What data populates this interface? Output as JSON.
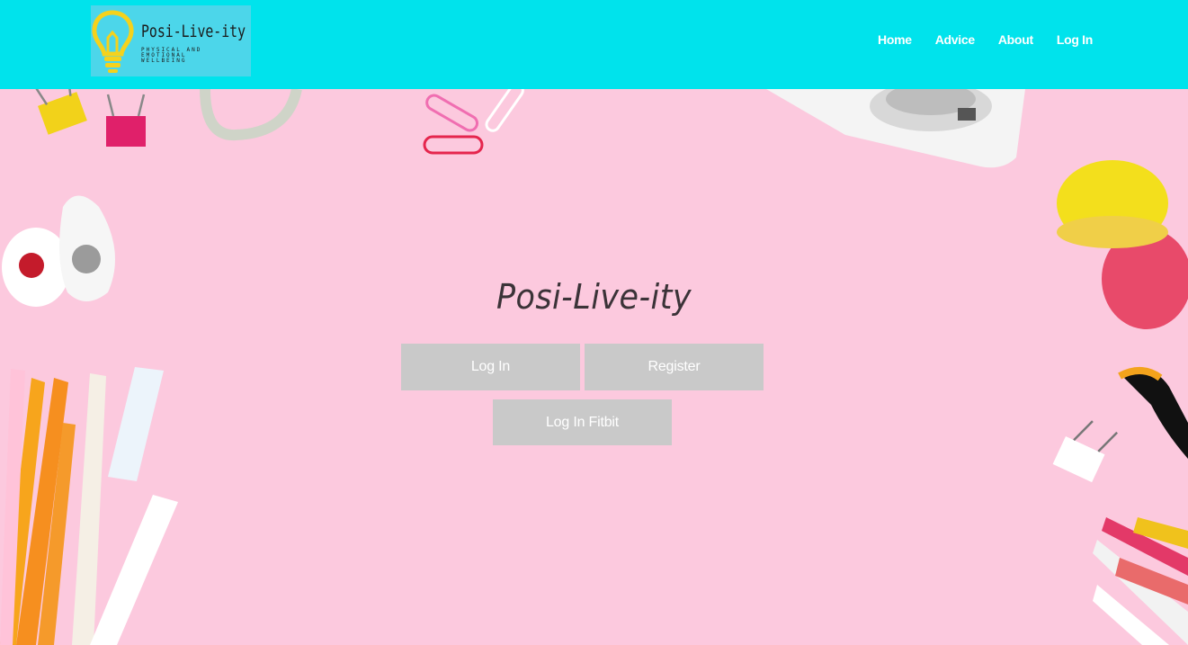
{
  "header": {
    "logo": {
      "title": "Posi-Live-ity",
      "subtitle": "Physical and emotional wellbeing"
    },
    "nav": [
      {
        "label": "Home"
      },
      {
        "label": "Advice"
      },
      {
        "label": "About"
      },
      {
        "label": "Log In"
      }
    ]
  },
  "hero": {
    "title": "Posi-Live-ity",
    "buttons": {
      "login": "Log In",
      "register": "Register",
      "fitbit": "Log In Fitbit"
    }
  },
  "colors": {
    "navbar": "#00e3ec",
    "background": "#fcc9de",
    "button": "#c9c9c9",
    "logo_bulb": "#f5d21c"
  },
  "icons": [
    "lightbulb-icon"
  ]
}
